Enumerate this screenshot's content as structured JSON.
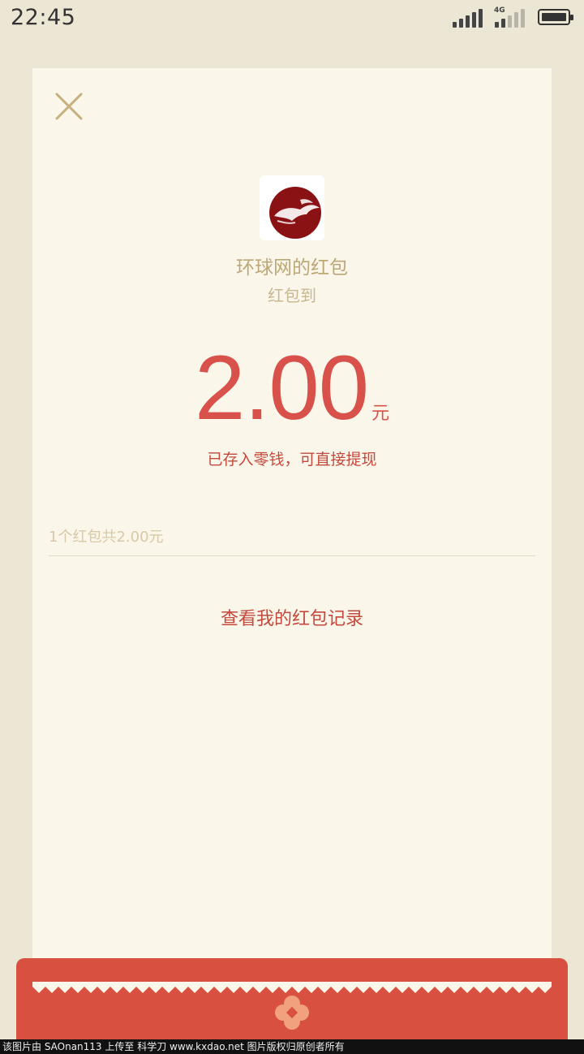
{
  "status_bar": {
    "time": "22:45",
    "network": "4G",
    "icons": [
      "signal-icon",
      "signal-4g-icon",
      "battery-icon"
    ]
  },
  "card": {
    "close_icon": "close-icon",
    "sender_name": "环球网的红包",
    "subtitle": "红包到",
    "amount": "2.00",
    "unit": "元",
    "hint": "已存入零钱，可直接提现",
    "summary": "1个红包共2.00元",
    "records_link": "查看我的红包记录"
  },
  "envelope": {
    "icon": "flower-icon"
  },
  "footer": {
    "text": "该图片由 SAOnan113 上传至 科学刀 www.kxdao.net 图片版权归原创者所有"
  },
  "colors": {
    "background": "#ece6d4",
    "card": "#faf6ea",
    "accent_red": "#d8514a",
    "gold_text": "#bda777"
  }
}
